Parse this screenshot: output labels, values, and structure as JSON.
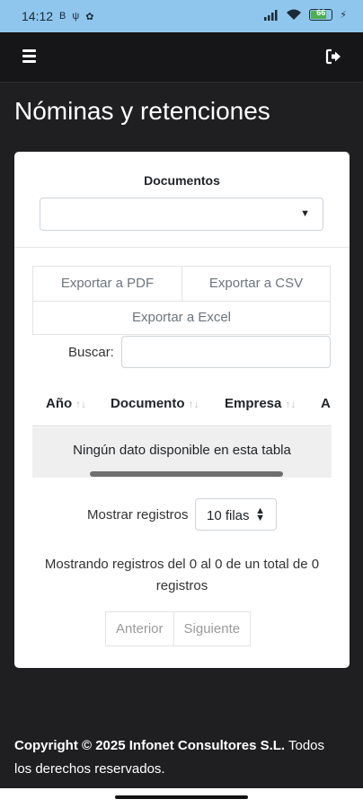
{
  "status_bar": {
    "time": "14:12",
    "battery": "66"
  },
  "page": {
    "title": "Nóminas y retenciones"
  },
  "filter": {
    "documents_label": "Documentos",
    "documents_value": ""
  },
  "export_buttons": {
    "pdf": "Exportar a PDF",
    "csv": "Exportar a CSV",
    "excel": "Exportar a Excel"
  },
  "search": {
    "label": "Buscar:",
    "value": ""
  },
  "table": {
    "columns": [
      "Año",
      "Documento",
      "Empresa",
      "A"
    ],
    "empty_message": "Ningún dato disponible en esta tabla"
  },
  "length": {
    "label": "Mostrar registros",
    "value": "10 filas"
  },
  "info": {
    "text": "Mostrando registros del 0 al 0 de un total de 0 registros"
  },
  "pagination": {
    "previous": "Anterior",
    "next": "Siguiente"
  },
  "footer": {
    "copyright": "Copyright © 2025 Infonet Consultores S.L.",
    "rights": " Todos los derechos reservados."
  },
  "colors": {
    "status_bar": "#8fc6ee",
    "background": "#1f1f22",
    "card": "#ffffff"
  }
}
